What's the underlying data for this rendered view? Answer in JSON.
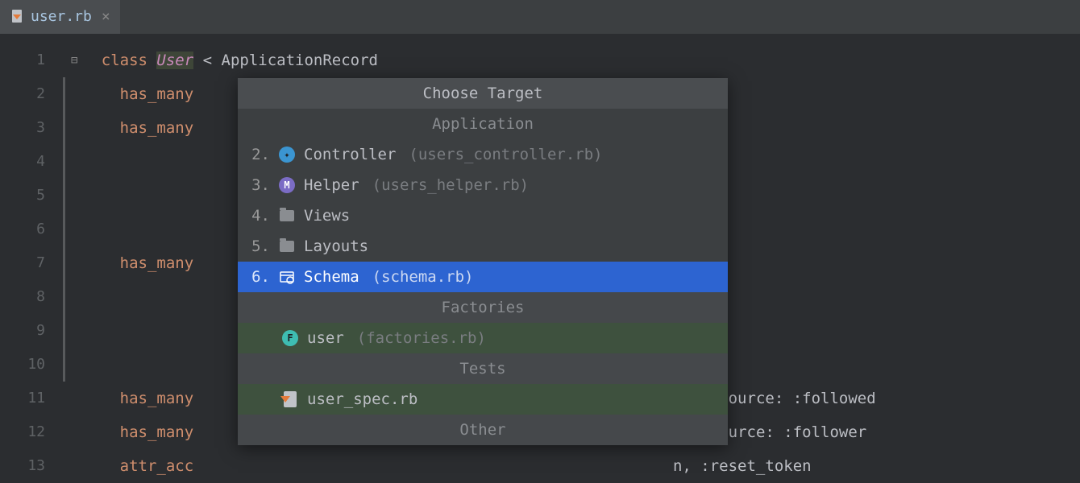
{
  "tab": {
    "label": "user.rb"
  },
  "lines": [
    "1",
    "2",
    "3",
    "4",
    "5",
    "6",
    "7",
    "8",
    "9",
    "10",
    "11",
    "12",
    "13"
  ],
  "code": {
    "l1": {
      "kw": "class",
      "ident": "User",
      "rest": " < ApplicationRecord"
    },
    "l2": "has_many",
    "l3": "has_many",
    "l7": "has_many",
    "l11": {
      "h": "has_many",
      "t": "ships,  source: :followed"
    },
    "l12": {
      "h": "has_many",
      "t": "nships, source: :follower"
    },
    "l13": {
      "h": "attr_acc",
      "t": "n, :reset_token"
    }
  },
  "popup": {
    "title": "Choose Target",
    "sections": {
      "app": "Application",
      "factories": "Factories",
      "tests": "Tests",
      "other": "Other"
    },
    "items": {
      "controller": {
        "num": "2.",
        "label": "Controller",
        "hint": "(users_controller.rb)"
      },
      "helper": {
        "num": "3.",
        "label": "Helper",
        "hint": "(users_helper.rb)"
      },
      "views": {
        "num": "4.",
        "label": "Views"
      },
      "layouts": {
        "num": "5.",
        "label": "Layouts"
      },
      "schema": {
        "num": "6.",
        "label": "Schema",
        "hint": "(schema.rb)"
      },
      "user": {
        "label": "user",
        "hint": "(factories.rb)"
      },
      "userspec": {
        "label": "user_spec.rb"
      }
    }
  }
}
